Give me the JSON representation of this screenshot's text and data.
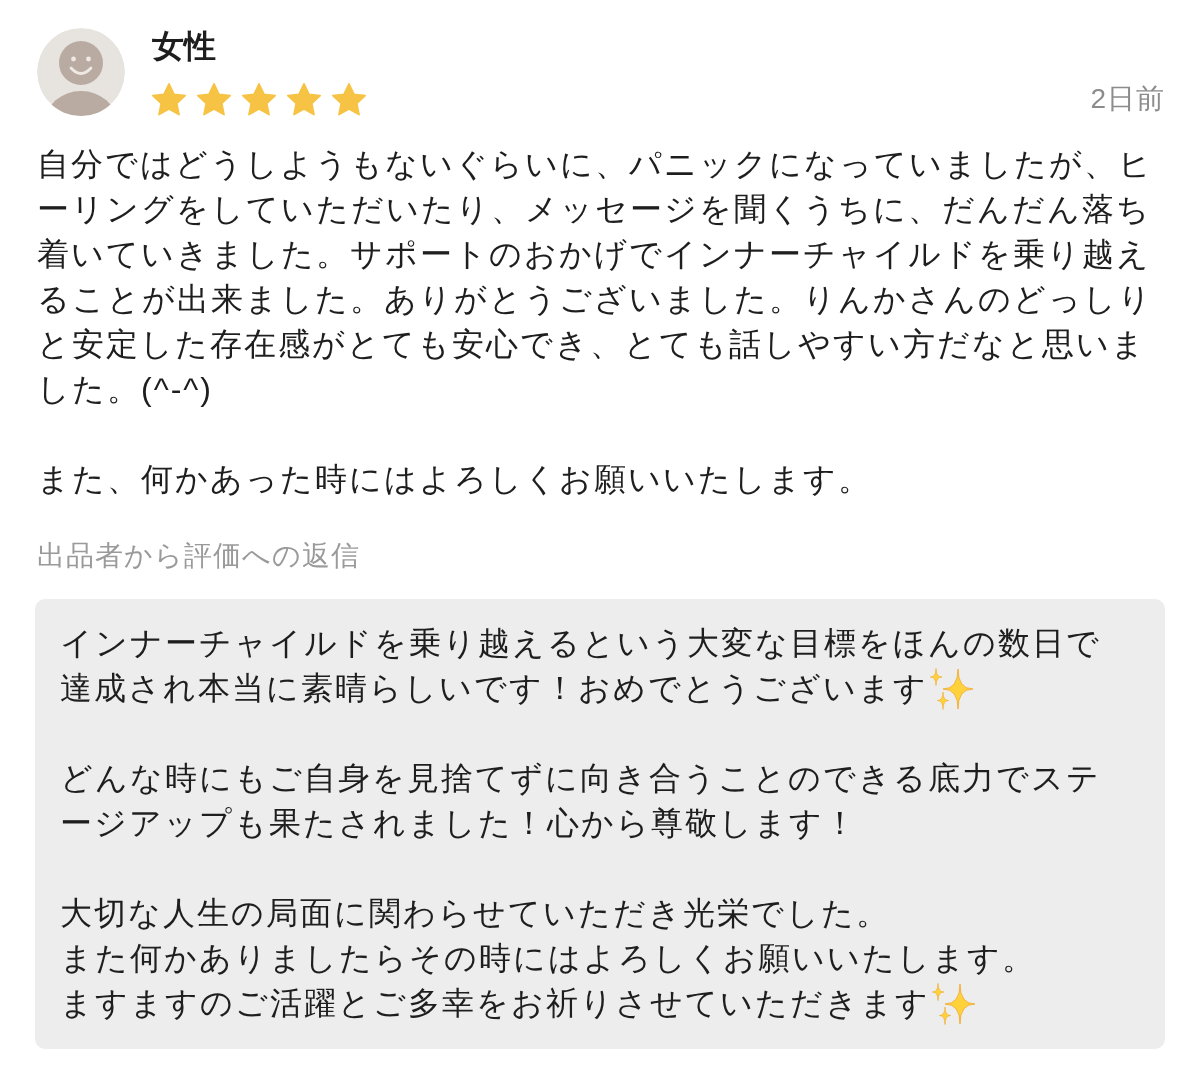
{
  "review": {
    "reviewer": {
      "name": "女性"
    },
    "stars": 5,
    "time": "2日前",
    "paragraphs": [
      "自分ではどうしようもないぐらいに、パニックになっていましたが、ヒーリングをしていただいたり、メッセージを聞くうちに、だんだん落ち着いていきました。サポートのおかげでインナーチャイルドを乗り越えることが出来ました。ありがとうございました。りんかさんのどっしりと安定した存在感がとても安心でき、とても話しやすい方だなと思いました。(^-^)",
      "また、何かあった時にはよろしくお願いいたします。"
    ]
  },
  "reply": {
    "heading": "出品者から評価への返信",
    "paragraphs": [
      {
        "lines": [
          {
            "text": "インナーチャイルドを乗り越えるという大変な目標をほんの数日で",
            "kind": "plain"
          },
          {
            "text": "達成され本当に素晴らしいです！おめでとうございます",
            "kind": "emoji_end"
          }
        ]
      },
      {
        "lines": [
          {
            "text": "どんな時にもご自身を見捨てずに向き合うことのできる底力でステージアップも果たされました！心から尊敬します！",
            "kind": "plain"
          }
        ]
      },
      {
        "lines": [
          {
            "text": "大切な人生の局面に関わらせていただき光栄でした。",
            "kind": "plain"
          },
          {
            "text": "また何かありましたらその時にはよろしくお願いいたします。",
            "kind": "plain"
          },
          {
            "text": "ますますのご活躍とご多幸をお祈りさせていただきます",
            "kind": "emoji_end"
          }
        ]
      }
    ]
  }
}
